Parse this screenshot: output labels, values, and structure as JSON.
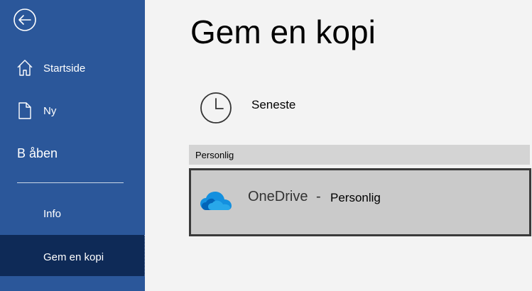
{
  "sidebar": {
    "back_icon": "back-arrow-circle-icon",
    "items": [
      {
        "label": "Startside",
        "icon": "home-icon"
      },
      {
        "label": "Ny",
        "icon": "new-document-icon"
      },
      {
        "label": "B åben"
      },
      {
        "label": "Info"
      },
      {
        "label": "Gem en kopi",
        "selected": true
      }
    ],
    "colors": {
      "background": "#2b579a",
      "selected": "#0e2a57"
    }
  },
  "main": {
    "title": "Gem en kopi",
    "recent": {
      "label": "Seneste",
      "icon": "clock-icon"
    },
    "section": {
      "label": "Personlig"
    },
    "location": {
      "name": "OneDrive",
      "separator": "-",
      "account": "Personlig",
      "icon": "onedrive-cloud-icon"
    }
  }
}
